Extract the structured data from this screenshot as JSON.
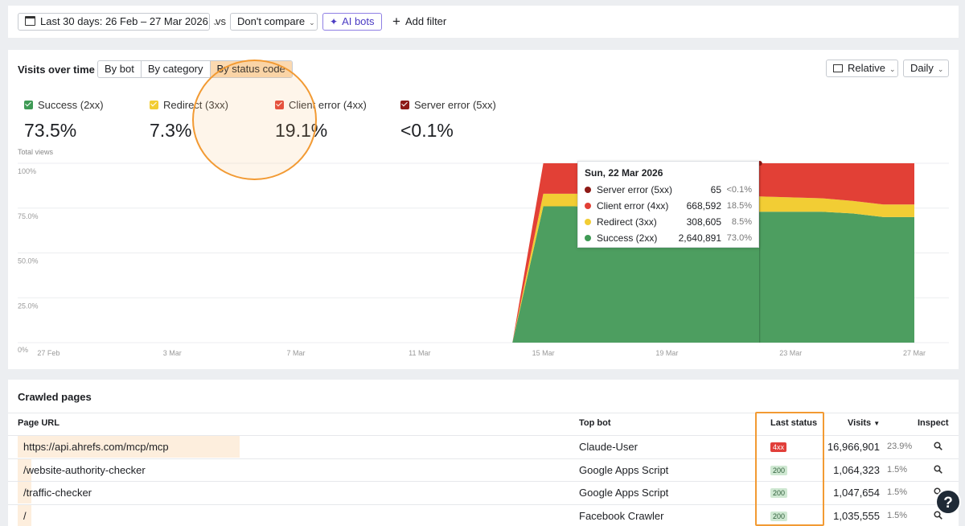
{
  "filters": {
    "date_range": "Last 30 days: 26 Feb – 27 Mar 2026",
    "vs": "vs",
    "compare": "Don't compare",
    "ai_bots": "AI bots",
    "add_filter": "Add filter"
  },
  "visits": {
    "title": "Visits over time",
    "tabs": [
      "By bot",
      "By category",
      "By status code"
    ],
    "active_tab": "By status code",
    "scale": "Relative",
    "interval": "Daily",
    "legend": [
      {
        "label": "Success (2xx)",
        "pct": "73.5%",
        "color": "#3f9a55"
      },
      {
        "label": "Redirect (3xx)",
        "pct": "7.3%",
        "color": "#f2cd34"
      },
      {
        "label": "Client error (4xx)",
        "pct": "19.1%",
        "color": "#e24036"
      },
      {
        "label": "Server error (5xx)",
        "pct": "<0.1%",
        "color": "#8e1a16"
      }
    ],
    "y_title": "Total views"
  },
  "chart_data": {
    "type": "area",
    "stacked": true,
    "relative": true,
    "ylabel": "Total views",
    "y_ticks": [
      "100%",
      "75.0%",
      "50.0%",
      "25.0%",
      "0%"
    ],
    "ylim": [
      0,
      100
    ],
    "x_ticks": [
      "27 Feb",
      "3 Mar",
      "7 Mar",
      "11 Mar",
      "15 Mar",
      "19 Mar",
      "23 Mar",
      "27 Mar"
    ],
    "x": [
      "2026-02-26",
      "2026-02-27",
      "2026-02-28",
      "2026-03-01",
      "2026-03-02",
      "2026-03-03",
      "2026-03-04",
      "2026-03-05",
      "2026-03-06",
      "2026-03-07",
      "2026-03-08",
      "2026-03-09",
      "2026-03-10",
      "2026-03-11",
      "2026-03-12",
      "2026-03-13",
      "2026-03-14",
      "2026-03-15",
      "2026-03-16",
      "2026-03-17",
      "2026-03-18",
      "2026-03-19",
      "2026-03-20",
      "2026-03-21",
      "2026-03-22",
      "2026-03-23",
      "2026-03-24",
      "2026-03-25",
      "2026-03-26",
      "2026-03-27"
    ],
    "series": [
      {
        "name": "Success (2xx)",
        "color": "#4d9e60",
        "values": [
          0,
          0,
          0,
          0,
          0,
          0,
          0,
          0,
          0,
          0,
          0,
          0,
          0,
          0,
          0,
          0,
          0,
          76,
          76,
          75.5,
          75,
          75,
          75,
          74,
          73,
          73,
          73,
          72,
          70,
          70
        ]
      },
      {
        "name": "Redirect (3xx)",
        "color": "#f2cd34",
        "values": [
          0,
          0,
          0,
          0,
          0,
          0,
          0,
          0,
          0,
          0,
          0,
          0,
          0,
          0,
          0,
          0,
          0,
          7,
          7,
          7.5,
          8,
          8,
          8,
          8.5,
          8.5,
          8,
          7.5,
          7,
          7,
          7
        ]
      },
      {
        "name": "Client error (4xx)",
        "color": "#e24036",
        "values": [
          0,
          0,
          0,
          0,
          0,
          0,
          0,
          0,
          0,
          0,
          0,
          0,
          0,
          0,
          0,
          0,
          0,
          17,
          17,
          17,
          17,
          17,
          17,
          17.5,
          18.5,
          19,
          19.5,
          21,
          23,
          23
        ]
      },
      {
        "name": "Server error (5xx)",
        "color": "#8e1a16",
        "values": [
          0,
          0,
          0,
          0,
          0,
          0,
          0,
          0,
          0,
          0,
          0,
          0,
          0,
          0,
          0,
          0,
          0,
          0,
          0,
          0,
          0,
          0,
          0,
          0,
          0,
          0,
          0,
          0,
          0,
          0
        ]
      }
    ],
    "tooltip": {
      "date": "Sun, 22 Mar 2026",
      "rows": [
        {
          "label": "Server error (5xx)",
          "value": "65",
          "pct": "<0.1%",
          "color": "#8e1a16"
        },
        {
          "label": "Client error (4xx)",
          "value": "668,592",
          "pct": "18.5%",
          "color": "#e24036"
        },
        {
          "label": "Redirect (3xx)",
          "value": "308,605",
          "pct": "8.5%",
          "color": "#f2cd34"
        },
        {
          "label": "Success (2xx)",
          "value": "2,640,891",
          "pct": "73.0%",
          "color": "#3f9a55"
        }
      ]
    }
  },
  "crawled": {
    "title": "Crawled pages",
    "headers": {
      "url": "Page URL",
      "bot": "Top bot",
      "status": "Last status",
      "visits": "Visits",
      "inspect": "Inspect"
    },
    "rows": [
      {
        "url": "https://api.ahrefs.com/mcp/mcp",
        "bot": "Claude-User",
        "status": "4xx",
        "visits": "16,966,901",
        "pct": "23.9%"
      },
      {
        "url": "/website-authority-checker",
        "bot": "Google Apps Script",
        "status": "200",
        "visits": "1,064,323",
        "pct": "1.5%"
      },
      {
        "url": "/traffic-checker",
        "bot": "Google Apps Script",
        "status": "200",
        "visits": "1,047,654",
        "pct": "1.5%"
      },
      {
        "url": "/",
        "bot": "Facebook Crawler",
        "status": "200",
        "visits": "1,035,555",
        "pct": "1.5%"
      }
    ]
  },
  "help_label": "?"
}
